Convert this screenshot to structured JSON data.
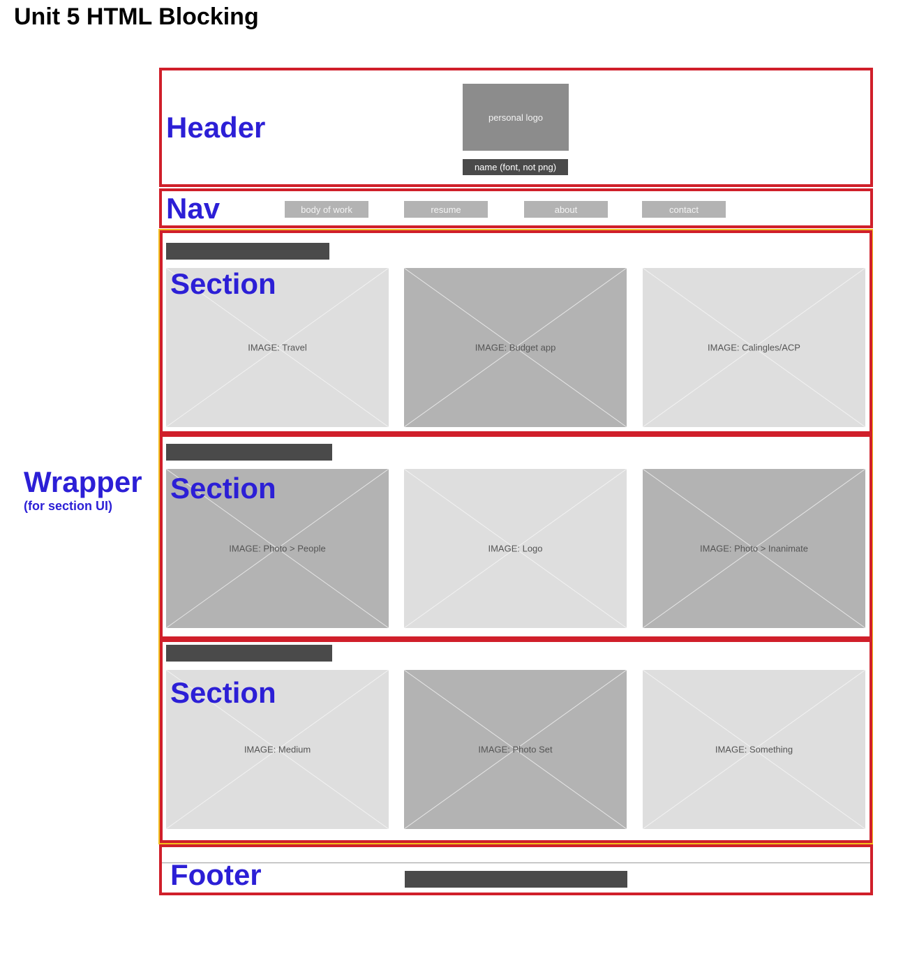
{
  "page": {
    "title": "Unit 5 HTML Blocking"
  },
  "labels": {
    "header": "Header",
    "nav": "Nav",
    "wrapper": "Wrapper",
    "wrapper_sub": "(for section UI)",
    "section": "Section",
    "footer": "Footer"
  },
  "header": {
    "logo_text": "personal logo",
    "name_text": "name (font, not png)"
  },
  "nav": {
    "items": [
      "body of work",
      "resume",
      "about",
      "contact"
    ]
  },
  "sections": [
    {
      "images": [
        "IMAGE: Travel",
        "IMAGE: Budget app",
        "IMAGE: Calingles/ACP"
      ]
    },
    {
      "images": [
        "IMAGE: Photo > People",
        "IMAGE: Logo",
        "IMAGE: Photo > Inanimate"
      ]
    },
    {
      "images": [
        "IMAGE: Medium",
        "IMAGE: Photo Set",
        "IMAGE: Something"
      ]
    }
  ],
  "colors": {
    "outline_red": "#d01f2a",
    "outline_yellow": "#f2c01c",
    "label_blue": "#2c1fd6",
    "placeholder_dark": "#b3b3b3",
    "placeholder_light": "#dedede",
    "bar_dark": "#4a4a4a"
  }
}
